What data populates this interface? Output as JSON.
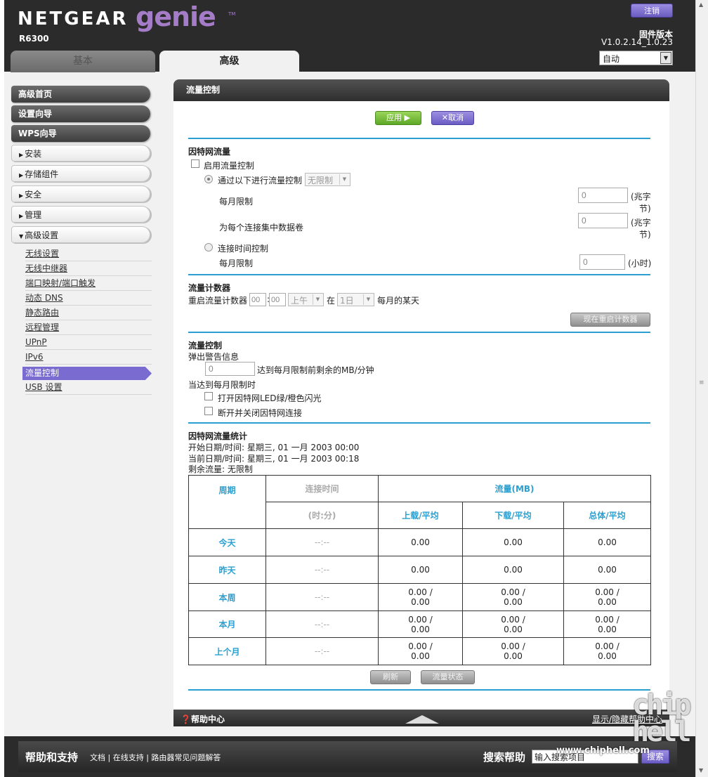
{
  "header": {
    "brand": "NETGEAR",
    "product": "genie",
    "tm": "TM",
    "model": "R6300",
    "logout_label": "注销",
    "firmware_label": "固件版本",
    "firmware_version": "V1.0.2.14_1.0.23",
    "language_value": "自动"
  },
  "tabs": {
    "basic": "基本",
    "advanced": "高级"
  },
  "sidebar": {
    "top": [
      "高级首页",
      "设置向导",
      "WPS向导"
    ],
    "groups": [
      "安装",
      "存储组件",
      "安全",
      "管理",
      "高级设置"
    ],
    "subitems": [
      "无线设置",
      "无线中继器",
      "端口映射/端口触发",
      "动态 DNS",
      "静态路由",
      "远程管理",
      "UPnP",
      "IPv6",
      "流量控制",
      "USB 设置"
    ]
  },
  "panel": {
    "title": "流量控制",
    "apply": "应用 ▶",
    "cancel": "✕取消",
    "internet_traffic": "因特网流量",
    "enable_meter": "启用流量控制",
    "by_volume": "通过以下进行流量控制",
    "volume_option": "无限制",
    "monthly_limit": "每月限制",
    "monthly_limit_value": "0",
    "unit_mb": "(兆字",
    "unit_mb2": "节)",
    "round_up": "为每个连接集中数据卷",
    "round_up_value": "0",
    "by_time": "连接时间控制",
    "monthly_time_limit": "每月限制",
    "time_value": "0",
    "unit_hours": "(小时)",
    "counter_title": "流量计数器",
    "restart_counter": "重启流量计数器",
    "hour_value": "00",
    "min_value": "00",
    "ampm_value": "上午",
    "at_label": "在",
    "day_value": "1日",
    "day_suffix": "每月的某天",
    "restart_now": "现在重启计数器",
    "control_title": "流量控制",
    "popup_warning": "弹出警告信息",
    "warning_value": "0",
    "warning_suffix": "达到每月限制前剩余的MB/分钟",
    "when_reached": "当达到每月限制时",
    "led_blink": "打开因特网LED绿/橙色闪光",
    "disconnect": "断开并关闭因特网连接",
    "stats_title": "因特网流量统计",
    "start_date": "开始日期/时间: 星期三, 01 一月 2003 00:00",
    "current_date": "当前日期/时间: 星期三, 01 一月 2003 00:18",
    "remaining": "剩余流量: 无限制",
    "refresh": "刷新",
    "traffic_status": "流量状态"
  },
  "table": {
    "h_period": "周期",
    "h_conn_time": "连接时间",
    "h_conn_unit": "(时:分)",
    "h_traffic": "流量(MB)",
    "h_upload": "上载/平均",
    "h_download": "下载/平均",
    "h_total": "总体/平均",
    "rows": [
      {
        "label": "今天",
        "time": "--:--",
        "up1": "0.00",
        "up2": "",
        "down1": "0.00",
        "down2": "",
        "total1": "0.00",
        "total2": ""
      },
      {
        "label": "昨天",
        "time": "--:--",
        "up1": "0.00",
        "up2": "",
        "down1": "0.00",
        "down2": "",
        "total1": "0.00",
        "total2": ""
      },
      {
        "label": "本周",
        "time": "--:--",
        "up1": "0.00 /",
        "up2": "0.00",
        "down1": "0.00 /",
        "down2": "0.00",
        "total1": "0.00 /",
        "total2": "0.00"
      },
      {
        "label": "本月",
        "time": "--:--",
        "up1": "0.00 /",
        "up2": "0.00",
        "down1": "0.00 /",
        "down2": "0.00",
        "total1": "0.00 /",
        "total2": "0.00"
      },
      {
        "label": "上个月",
        "time": "--:--",
        "up1": "0.00 /",
        "up2": "0.00",
        "down1": "0.00 /",
        "down2": "0.00",
        "total1": "0.00 /",
        "total2": "0.00"
      }
    ]
  },
  "footer_panel": {
    "help_center": "帮助中心",
    "toggle_help": "显示/隐藏帮助中心"
  },
  "bottom": {
    "title": "帮助和支持",
    "links": "文档 | 在线支持 | 路由器常见问题解答",
    "search_title": "搜索帮助",
    "search_placeholder": "输入搜索项目",
    "search_btn": "搜索"
  },
  "watermark": {
    "text": "chip hell",
    "url": "www.chiphell.com"
  }
}
